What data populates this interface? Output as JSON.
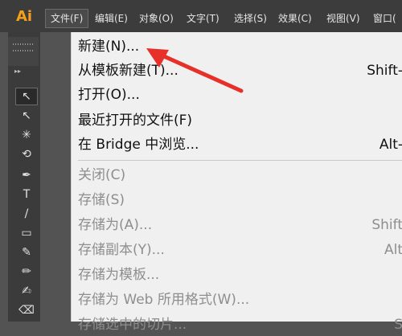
{
  "app": {
    "logo_text": "Ai"
  },
  "menubar": {
    "items": [
      {
        "label": "文件(F)"
      },
      {
        "label": "编辑(E)"
      },
      {
        "label": "对象(O)"
      },
      {
        "label": "文字(T)"
      },
      {
        "label": "选择(S)"
      },
      {
        "label": "效果(C)"
      },
      {
        "label": "视图(V)"
      },
      {
        "label": "窗口("
      }
    ]
  },
  "toolbar": {
    "tools": [
      {
        "icon": "selection-tool-icon",
        "glyph": "↖"
      },
      {
        "icon": "direct-selection-tool-icon",
        "glyph": "↖"
      },
      {
        "icon": "magic-wand-tool-icon",
        "glyph": "✳"
      },
      {
        "icon": "lasso-tool-icon",
        "glyph": "⟲"
      },
      {
        "icon": "pen-tool-icon",
        "glyph": "✒"
      },
      {
        "icon": "type-tool-icon",
        "glyph": "T"
      },
      {
        "icon": "line-tool-icon",
        "glyph": "/"
      },
      {
        "icon": "rectangle-tool-icon",
        "glyph": "▭"
      },
      {
        "icon": "paintbrush-tool-icon",
        "glyph": "✎"
      },
      {
        "icon": "pencil-tool-icon",
        "glyph": "✏"
      },
      {
        "icon": "blob-brush-tool-icon",
        "glyph": "✍"
      },
      {
        "icon": "eraser-tool-icon",
        "glyph": "⌫"
      }
    ]
  },
  "file_menu": {
    "items": [
      {
        "label": "新建(N)...",
        "shortcut": "",
        "enabled": true
      },
      {
        "label": "从模板新建(T)...",
        "shortcut": "Shift-",
        "enabled": true
      },
      {
        "label": "打开(O)...",
        "shortcut": "",
        "enabled": true
      },
      {
        "label": "最近打开的文件(F)",
        "shortcut": "",
        "enabled": true
      },
      {
        "label": "在 Bridge 中浏览...",
        "shortcut": "Alt-",
        "enabled": true
      },
      {
        "label": "关闭(C)",
        "shortcut": "",
        "enabled": false
      },
      {
        "label": "存储(S)",
        "shortcut": "",
        "enabled": false
      },
      {
        "label": "存储为(A)...",
        "shortcut": "Shift",
        "enabled": false
      },
      {
        "label": "存储副本(Y)...",
        "shortcut": "Alt",
        "enabled": false
      },
      {
        "label": "存储为模板...",
        "shortcut": "",
        "enabled": false
      },
      {
        "label": "存储为 Web 所用格式(W)...",
        "shortcut": "",
        "enabled": false
      },
      {
        "label": "存储选中的切片...",
        "shortcut": "S",
        "enabled": false
      }
    ]
  },
  "annotation": {
    "color": "#e8302a"
  }
}
